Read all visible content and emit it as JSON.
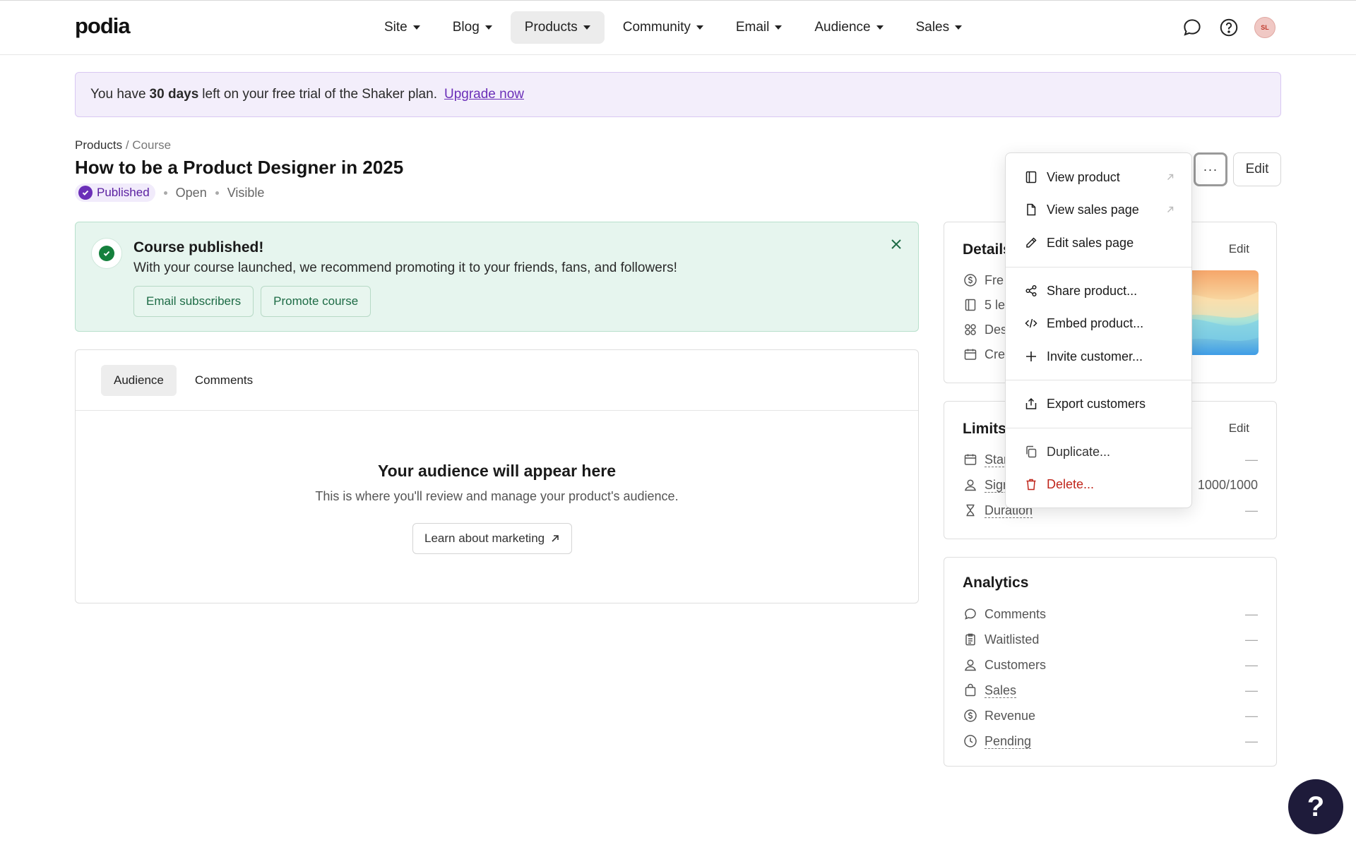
{
  "brand": {
    "logo": "podia"
  },
  "nav": {
    "items": [
      {
        "label": "Site",
        "active": false
      },
      {
        "label": "Blog",
        "active": false
      },
      {
        "label": "Products",
        "active": true
      },
      {
        "label": "Community",
        "active": false
      },
      {
        "label": "Email",
        "active": false
      },
      {
        "label": "Audience",
        "active": false
      },
      {
        "label": "Sales",
        "active": false
      }
    ],
    "avatar_initials": "SL",
    "icons": [
      "chat-bubble-icon",
      "help-circle-icon"
    ]
  },
  "trial_banner": {
    "prefix": "You have",
    "days": "30 days",
    "suffix": "left on your free trial of the Shaker plan.",
    "link": "Upgrade now"
  },
  "header": {
    "breadcrumb_root": "Products",
    "breadcrumb_sep": "/",
    "breadcrumb_current": "Course",
    "title": "How to be a Product Designer in 2025",
    "status": "Published",
    "access": "Open",
    "visibility": "Visible",
    "more_label": "···",
    "edit_label": "Edit"
  },
  "success": {
    "title": "Course published!",
    "description": "With your course launched, we recommend promoting it to your friends, fans, and followers!",
    "buttons": [
      "Email subscribers",
      "Promote course"
    ]
  },
  "audience": {
    "tabs": [
      {
        "label": "Audience",
        "active": true
      },
      {
        "label": "Comments",
        "active": false
      }
    ],
    "empty_title": "Your audience will appear here",
    "empty_desc": "This is where you'll review and manage your product's audience.",
    "learn_button": "Learn about marketing"
  },
  "details": {
    "title": "Details",
    "edit": "Edit",
    "rows": [
      {
        "icon": "dollar-circle-icon",
        "label": "Fre"
      },
      {
        "icon": "book-icon",
        "label": "5 le"
      },
      {
        "icon": "grid-icon",
        "label": "Des"
      },
      {
        "icon": "calendar-icon",
        "label": "Cre"
      }
    ]
  },
  "limits": {
    "title": "Limits",
    "edit": "Edit",
    "rows": [
      {
        "icon": "calendar-icon",
        "label": "Star",
        "value": "—"
      },
      {
        "icon": "user-icon",
        "label": "Sign",
        "value": "1000/1000"
      },
      {
        "icon": "hourglass-icon",
        "label": "Duration",
        "value": "—"
      }
    ]
  },
  "analytics": {
    "title": "Analytics",
    "rows": [
      {
        "icon": "comment-icon",
        "label": "Comments",
        "value": "—"
      },
      {
        "icon": "clipboard-icon",
        "label": "Waitlisted",
        "value": "—"
      },
      {
        "icon": "user-icon",
        "label": "Customers",
        "value": "—"
      },
      {
        "icon": "bag-icon",
        "label": "Sales",
        "value": "—"
      },
      {
        "icon": "dollar-circle-icon",
        "label": "Revenue",
        "value": "—"
      },
      {
        "icon": "clock-icon",
        "label": "Pending",
        "value": "—"
      }
    ]
  },
  "menu": {
    "items": [
      {
        "label": "View product",
        "icon": "book-icon",
        "external": true
      },
      {
        "label": "View sales page",
        "icon": "file-icon",
        "external": true
      },
      {
        "label": "Edit sales page",
        "icon": "pencil-icon",
        "external": false
      },
      {
        "label": "Share product...",
        "icon": "share-icon",
        "external": false
      },
      {
        "label": "Embed product...",
        "icon": "code-icon",
        "external": false
      },
      {
        "label": "Invite customer...",
        "icon": "plus-icon",
        "external": false
      },
      {
        "label": "Export customers",
        "icon": "export-icon",
        "external": false
      },
      {
        "label": "Duplicate...",
        "icon": "copy-icon",
        "external": false
      },
      {
        "label": "Delete...",
        "icon": "trash-icon",
        "external": false,
        "danger": true
      }
    ]
  },
  "help_bubble": "?",
  "colors": {
    "brand_purple": "#6b2fb8",
    "success_green": "#15803d",
    "danger_red": "#c0261b",
    "trial_bg": "#f3eefb"
  }
}
